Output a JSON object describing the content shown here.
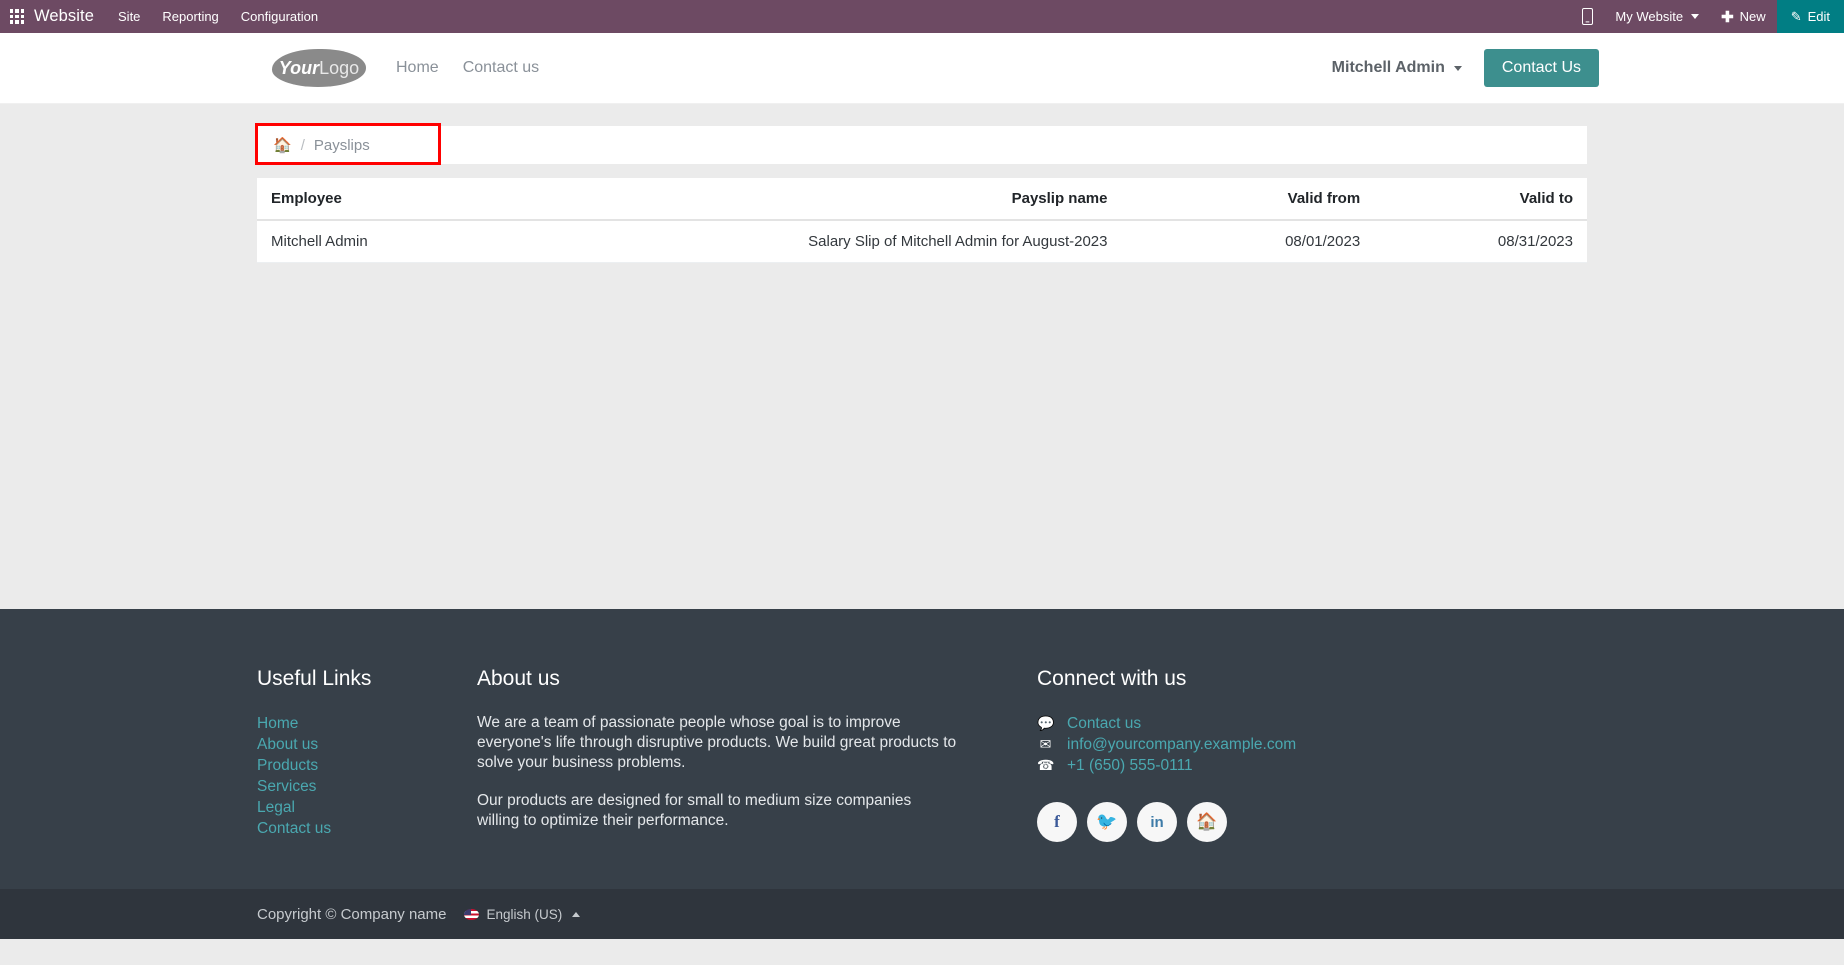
{
  "topbar": {
    "apps_icon": "apps-grid-icon",
    "brand": "Website",
    "menu": [
      "Site",
      "Reporting",
      "Configuration"
    ],
    "mobile_icon": "mobile-preview-icon",
    "website_selector": "My Website",
    "new_label": "New",
    "new_icon": "plus-icon",
    "edit_label": "Edit",
    "edit_icon": "pencil-icon",
    "bg_color": "#6d4a63",
    "edit_bg_color": "#017e84"
  },
  "site_header": {
    "logo": {
      "bold": "Your",
      "light": "Logo"
    },
    "nav": [
      "Home",
      "Contact us"
    ],
    "user": "Mitchell Admin",
    "cta_label": "Contact Us",
    "cta_color": "#3d8f8e"
  },
  "breadcrumb": {
    "home_icon": "home-icon",
    "separator": "/",
    "current": "Payslips",
    "highlight_color": "#ff0000"
  },
  "table": {
    "headers": [
      "Employee",
      "Payslip name",
      "Valid from",
      "Valid to"
    ],
    "rows": [
      {
        "employee": "Mitchell Admin",
        "payslip_name": "Salary Slip of Mitchell Admin for August-2023",
        "valid_from": "08/01/2023",
        "valid_to": "08/31/2023"
      }
    ]
  },
  "footer": {
    "useful_links": {
      "title": "Useful Links",
      "items": [
        "Home",
        "About us",
        "Products",
        "Services",
        "Legal",
        "Contact us"
      ]
    },
    "about": {
      "title": "About us",
      "paragraphs": [
        "We are a team of passionate people whose goal is to improve everyone's life through disruptive products. We build great products to solve your business problems.",
        "Our products are designed for small to medium size companies willing to optimize their performance."
      ]
    },
    "connect": {
      "title": "Connect with us",
      "contact_label": "Contact us",
      "contact_icon": "comment-icon",
      "email": "info@yourcompany.example.com",
      "email_icon": "envelope-icon",
      "phone": "+1 (650) 555-0111",
      "phone_icon": "phone-icon",
      "socials": [
        {
          "name": "facebook-icon",
          "glyph": "f"
        },
        {
          "name": "twitter-icon",
          "glyph": "🐦"
        },
        {
          "name": "linkedin-icon",
          "glyph": "in"
        },
        {
          "name": "home-icon",
          "glyph": "🏠"
        }
      ]
    },
    "copyright": "Copyright © Company name",
    "language": "English (US)",
    "bg_color": "#374049",
    "copyright_bg_color": "#2f353d",
    "link_color": "#4aa8b0"
  }
}
